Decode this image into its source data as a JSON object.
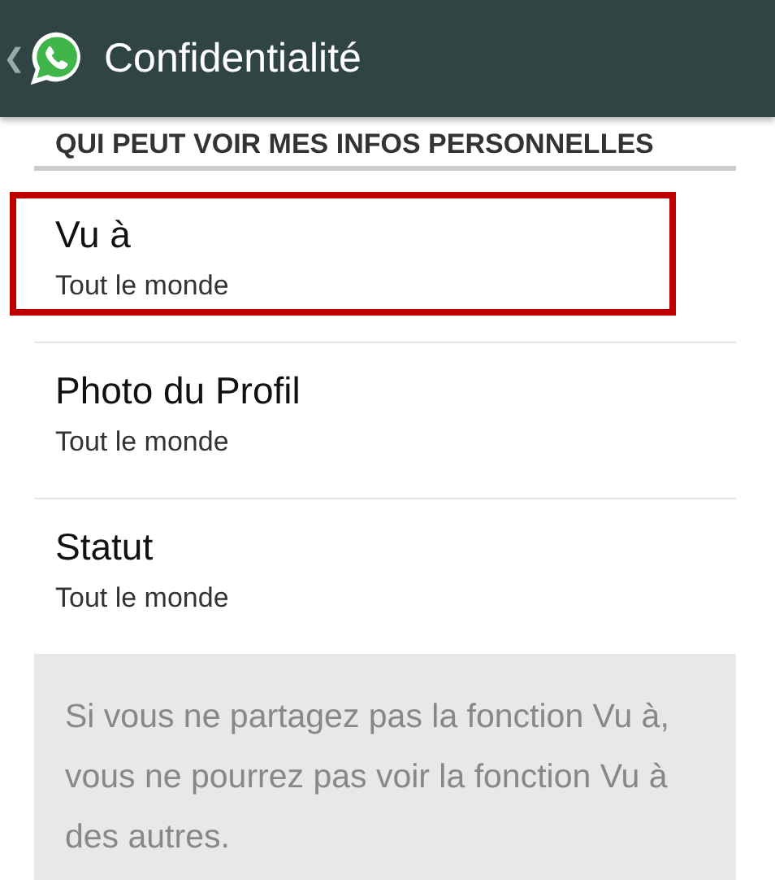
{
  "header": {
    "back": "❮",
    "title": "Confidentialité"
  },
  "section": {
    "title": "QUI PEUT VOIR MES INFOS PERSONNELLES"
  },
  "items": [
    {
      "title": "Vu à",
      "value": "Tout le monde",
      "highlighted": true
    },
    {
      "title": "Photo du Profil",
      "value": "Tout le monde",
      "highlighted": false
    },
    {
      "title": "Statut",
      "value": "Tout le monde",
      "highlighted": false
    }
  ],
  "note": "Si vous ne partagez pas la fonction Vu à, vous ne pourrez pas voir la fonction Vu à des autres."
}
